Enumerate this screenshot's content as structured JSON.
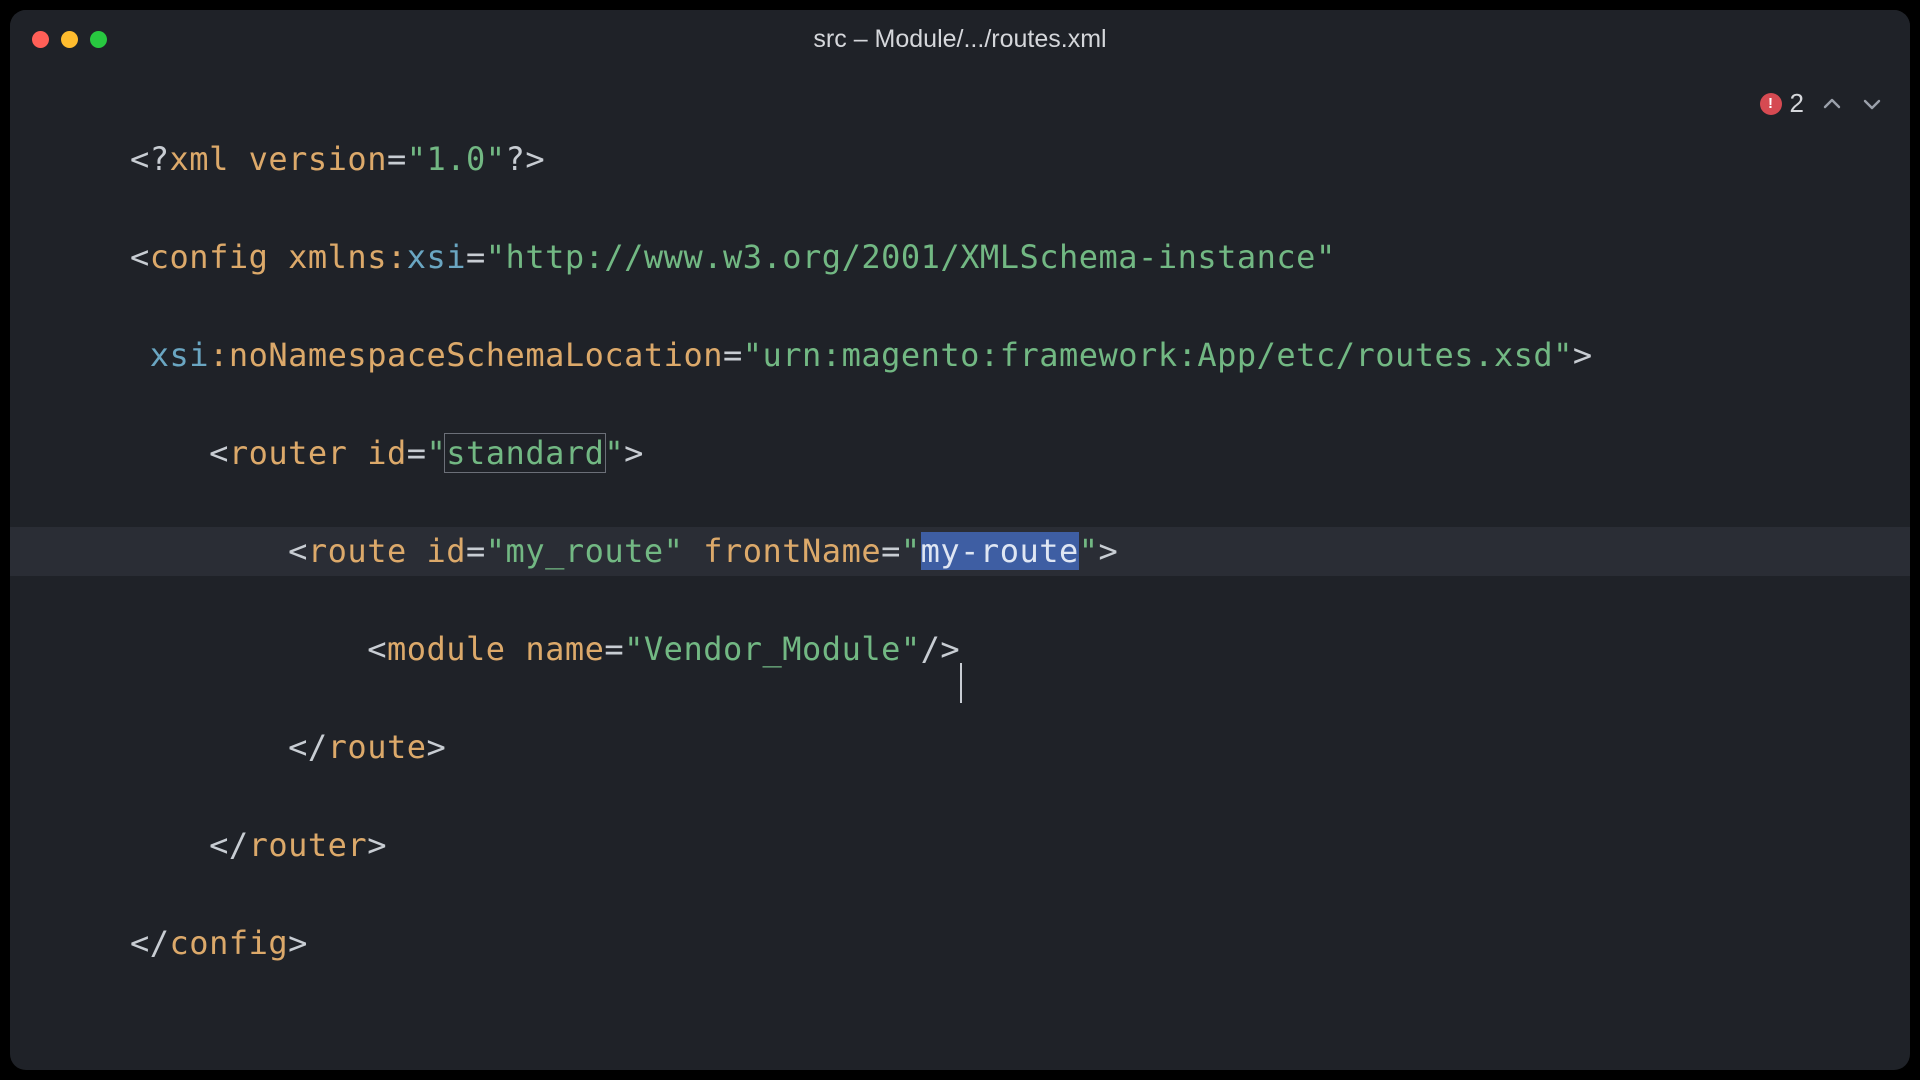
{
  "window": {
    "title": "src – Module/.../routes.xml"
  },
  "problems": {
    "error_count": "2"
  },
  "code": {
    "l1": {
      "open": "<?",
      "pi": "xml",
      "sp": " ",
      "attr": "version",
      "eq": "=",
      "val": "\"1.0\"",
      "close": "?>"
    },
    "l2": {
      "open": "<",
      "tag": "config",
      "sp": " ",
      "nsPre": "xmlns:",
      "ns": "xsi",
      "eq": "=",
      "val": "\"http://www.w3.org/2001/XMLSchema-instance\""
    },
    "l3": {
      "pad": " ",
      "nsPre": "xsi",
      "nsCol": ":",
      "attr": "noNamespaceSchemaLocation",
      "eq": "=",
      "val": "\"urn:magento:framework:App/етc/routes.xsd\"",
      "close": ">"
    },
    "l3b": {
      "val": "\"urn:magento:framework:App/etc/routes.xsd\""
    },
    "l4": {
      "pad": "    ",
      "open": "<",
      "tag": "router",
      "sp": " ",
      "attr": "id",
      "eq": "=",
      "q1": "\"",
      "valInner": "standard",
      "q2": "\"",
      "close": ">"
    },
    "l5": {
      "pad": "        ",
      "open": "<",
      "tag": "route",
      "sp1": " ",
      "attr1": "id",
      "eq1": "=",
      "val1": "\"my_route\"",
      "sp2": " ",
      "attr2": "frontName",
      "eq2": "=",
      "q1": "\"",
      "sel": "my-route",
      "q2": "\"",
      "close": ">"
    },
    "l6": {
      "pad": "            ",
      "open": "<",
      "tag": "module",
      "sp": " ",
      "attr": "name",
      "eq": "=",
      "val": "\"Vendor_Module\"",
      "close": "/>"
    },
    "l7": {
      "pad": "        ",
      "open": "</",
      "tag": "route",
      "close": ">"
    },
    "l8": {
      "pad": "    ",
      "open": "</",
      "tag": "router",
      "close": ">"
    },
    "l9": {
      "open": "</",
      "tag": "config",
      "close": ">"
    }
  }
}
